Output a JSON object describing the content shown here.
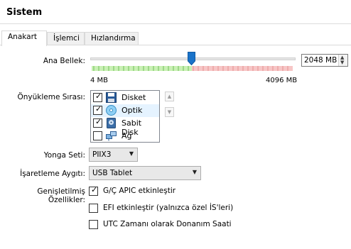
{
  "header": {
    "title": "Sistem"
  },
  "tabs": [
    {
      "label": "Anakart"
    },
    {
      "label": "İşlemci"
    },
    {
      "label": "Hızlandırma"
    }
  ],
  "memory": {
    "label": "Ana Bellek:",
    "value_mb": 2048,
    "value_text": "2048 MB",
    "min_label": "4 MB",
    "max_label": "4096 MB",
    "slider_fraction": 0.5,
    "colors": {
      "safe": "#c9f0b4",
      "warn": "#fbe3c2",
      "danger": "#f7c6c6",
      "thumb": "#1a73c9"
    }
  },
  "boot_order": {
    "label": "Önyükleme Sırası:",
    "items": [
      {
        "label": "Disket",
        "checked": true,
        "icon": "floppy-icon"
      },
      {
        "label": "Optik",
        "checked": true,
        "icon": "optical-disc-icon"
      },
      {
        "label": "Sabit Disk",
        "checked": true,
        "icon": "hard-disk-icon"
      },
      {
        "label": "Ağ",
        "checked": false,
        "icon": "network-icon"
      }
    ],
    "move_up_icon": "arrow-up-icon",
    "move_down_icon": "arrow-down-icon"
  },
  "chipset": {
    "label": "Yonga Seti:",
    "value": "PIIX3"
  },
  "pointing": {
    "label": "İşaretleme Aygıtı:",
    "value": "USB Tablet"
  },
  "extended": {
    "label": "Genişletilmiş Özellikler:",
    "options": [
      {
        "label": "G/Ç APIC etkinleştir",
        "checked": true
      },
      {
        "label": "EFI etkinleştir (yalnızca özel İS'leri)",
        "checked": false
      },
      {
        "label": "UTC Zamanı olarak Donanım Saati",
        "checked": false
      }
    ]
  }
}
